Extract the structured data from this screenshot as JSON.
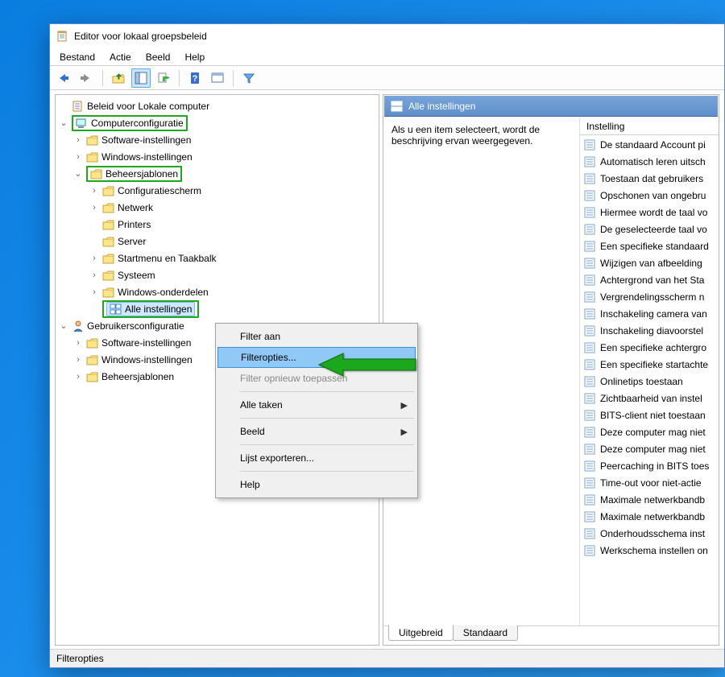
{
  "window_title": "Editor voor lokaal groepsbeleid",
  "menubar": {
    "file": "Bestand",
    "action": "Actie",
    "view": "Beeld",
    "help": "Help"
  },
  "tree": {
    "root": "Beleid voor Lokale computer",
    "computer_config": "Computerconfiguratie",
    "computer_children": {
      "software": "Software-instellingen",
      "windows": "Windows-instellingen",
      "templates": "Beheersjablonen",
      "tmpl_children": {
        "config_panel": "Configuratiescherm",
        "network": "Netwerk",
        "printers": "Printers",
        "server": "Server",
        "startmenu": "Startmenu en Taakbalk",
        "system": "Systeem",
        "win_components": "Windows-onderdelen",
        "all_settings": "Alle instellingen"
      }
    },
    "user_config": "Gebruikersconfiguratie",
    "user_children": {
      "software": "Software-instellingen",
      "windows": "Windows-instellingen",
      "templates": "Beheersjablonen"
    }
  },
  "detail": {
    "header": "Alle instellingen",
    "desc": "Als u een item selecteert, wordt de beschrijving ervan weergegeven.",
    "column_header": "Instelling",
    "items": [
      "De standaard Account pi",
      "Automatisch leren uitsch",
      "Toestaan dat gebruikers",
      "Opschonen van ongebru",
      "Hiermee wordt de taal vo",
      "De geselecteerde taal vo",
      "Een specifieke standaard",
      "Wijzigen van afbeelding",
      "Achtergrond van het Sta",
      "Vergrendelingsscherm n",
      "Inschakeling camera van",
      "Inschakeling diavoorstel",
      "Een specifieke achtergro",
      "Een specifieke startachte",
      "Onlinetips toestaan",
      "Zichtbaarheid van instel",
      "BITS-client niet toestaan",
      "Deze computer mag niet",
      "Deze computer mag niet",
      "Peercaching in BITS toes",
      "Time-out voor niet-actie",
      "Maximale netwerkbandb",
      "Maximale netwerkbandb",
      "Onderhoudsschema inst",
      "Werkschema instellen on"
    ]
  },
  "tabs": {
    "extended": "Uitgebreid",
    "standard": "Standaard"
  },
  "context_menu": {
    "filter_on": "Filter aan",
    "filter_options": "Filteropties...",
    "filter_reapply": "Filter opnieuw toepassen",
    "all_tasks": "Alle taken",
    "view": "Beeld",
    "export_list": "Lijst exporteren...",
    "help": "Help"
  },
  "statusbar": "Filteropties"
}
